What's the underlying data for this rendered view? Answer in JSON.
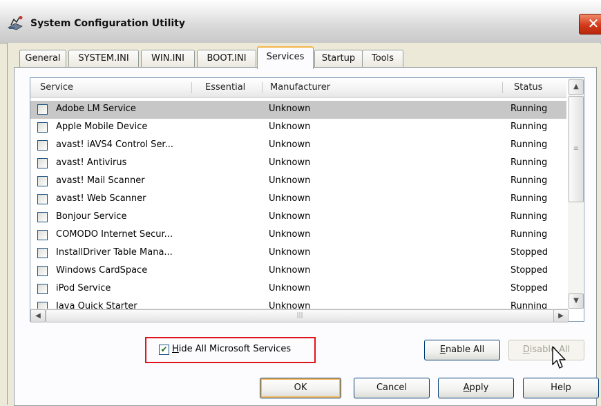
{
  "window": {
    "title": "System Configuration Utility",
    "close_symbol": "✕"
  },
  "tabs": [
    {
      "label": "General"
    },
    {
      "label": "SYSTEM.INI"
    },
    {
      "label": "WIN.INI"
    },
    {
      "label": "BOOT.INI"
    },
    {
      "label": "Services"
    },
    {
      "label": "Startup"
    },
    {
      "label": "Tools"
    }
  ],
  "active_tab": "Services",
  "list": {
    "columns": [
      "Service",
      "Essential",
      "Manufacturer",
      "Status"
    ],
    "rows": [
      {
        "service": "Adobe LM Service",
        "essential": "",
        "manufacturer": "Unknown",
        "status": "Running",
        "checked": false,
        "selected": true
      },
      {
        "service": "Apple Mobile Device",
        "essential": "",
        "manufacturer": "Unknown",
        "status": "Running",
        "checked": false
      },
      {
        "service": "avast! iAVS4 Control Ser...",
        "essential": "",
        "manufacturer": "Unknown",
        "status": "Running",
        "checked": false
      },
      {
        "service": "avast! Antivirus",
        "essential": "",
        "manufacturer": "Unknown",
        "status": "Running",
        "checked": false
      },
      {
        "service": "avast! Mail Scanner",
        "essential": "",
        "manufacturer": "Unknown",
        "status": "Running",
        "checked": false
      },
      {
        "service": "avast! Web Scanner",
        "essential": "",
        "manufacturer": "Unknown",
        "status": "Running",
        "checked": false
      },
      {
        "service": "Bonjour Service",
        "essential": "",
        "manufacturer": "Unknown",
        "status": "Running",
        "checked": false
      },
      {
        "service": "COMODO Internet Secur...",
        "essential": "",
        "manufacturer": "Unknown",
        "status": "Running",
        "checked": false
      },
      {
        "service": "InstallDriver Table Mana...",
        "essential": "",
        "manufacturer": "Unknown",
        "status": "Stopped",
        "checked": false
      },
      {
        "service": "Windows CardSpace",
        "essential": "",
        "manufacturer": "Unknown",
        "status": "Stopped",
        "checked": false
      },
      {
        "service": "iPod Service",
        "essential": "",
        "manufacturer": "Unknown",
        "status": "Stopped",
        "checked": false
      },
      {
        "service": "Java Quick Starter",
        "essential": "",
        "manufacturer": "Unknown",
        "status": "Running",
        "checked": false
      }
    ]
  },
  "hide_ms": {
    "label_prefix": "H",
    "label_rest": "ide All Microsoft Services",
    "checked": true
  },
  "buttons": {
    "enable_all": {
      "u": "E",
      "rest": "nable All"
    },
    "disable_all": {
      "u": "D",
      "rest": "isable All"
    },
    "ok": "OK",
    "cancel": "Cancel",
    "apply": {
      "u": "A",
      "rest": "pply"
    },
    "help": "Help"
  },
  "colors": {
    "highlight_box": "#e0141b",
    "selected_row": "#c7c7c7",
    "active_tab_accent": "#f5b64a"
  }
}
